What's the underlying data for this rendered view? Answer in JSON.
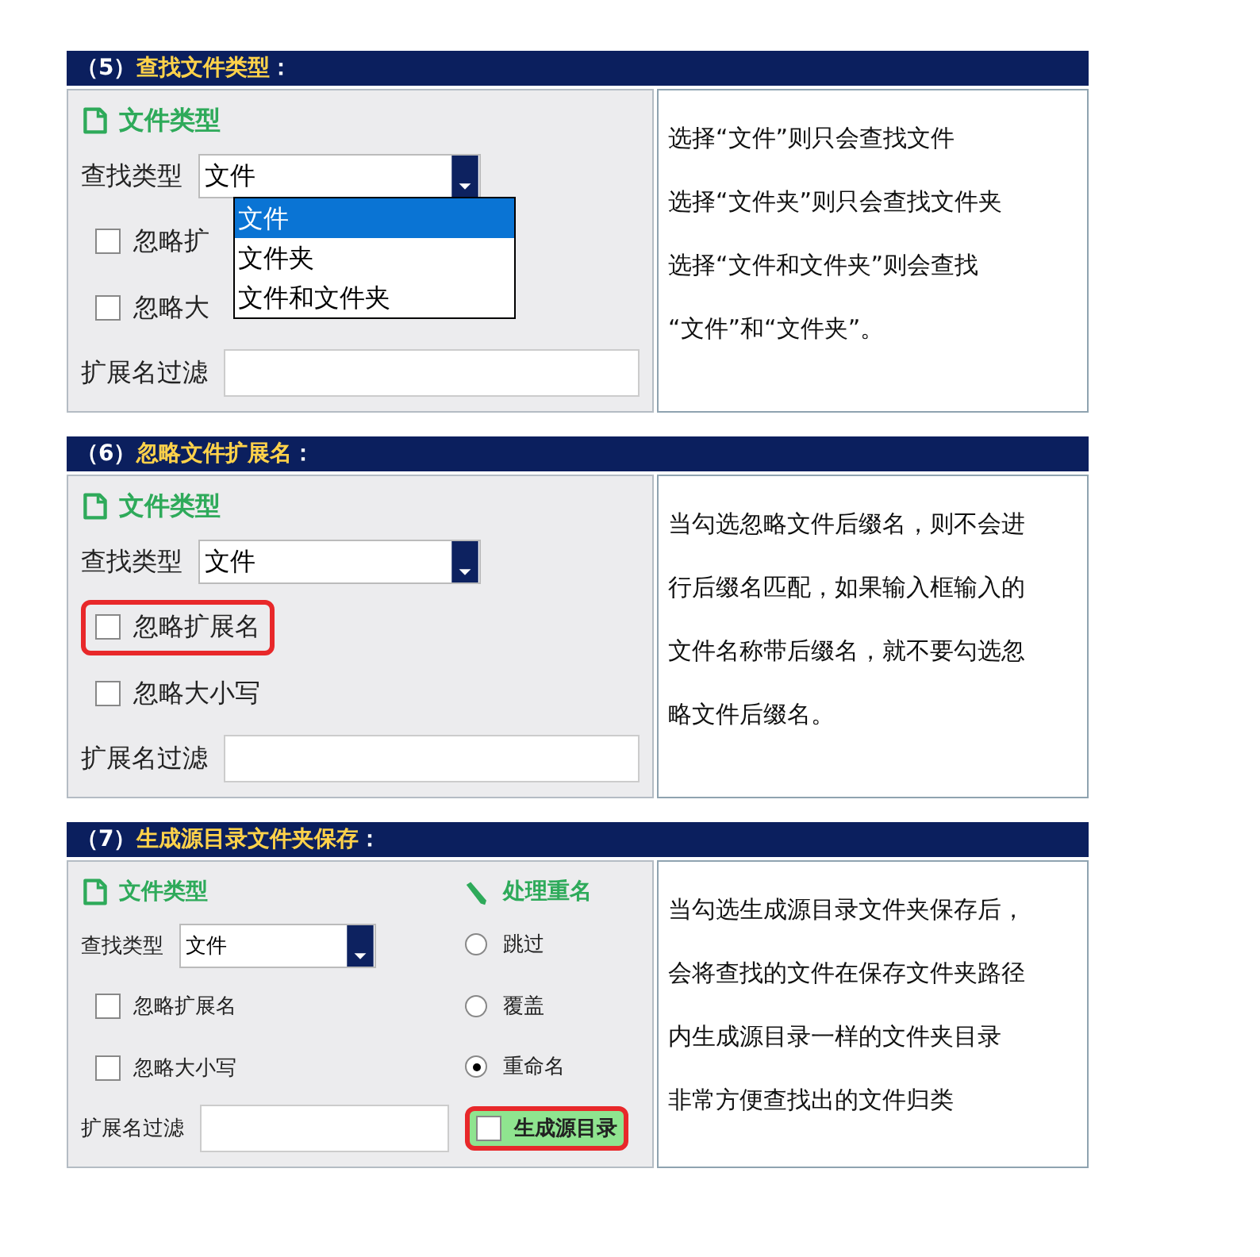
{
  "sections": [
    {
      "number": "（5）",
      "title": "查找文件类型",
      "suffix": "：",
      "file_type": {
        "heading": "文件类型",
        "search_type_label": "查找类型",
        "search_type_value": "文件",
        "dropdown_options": [
          {
            "label": "文件",
            "selected": true
          },
          {
            "label": "文件夹",
            "selected": false
          },
          {
            "label": "文件和文件夹",
            "selected": false
          }
        ],
        "checkboxes": [
          {
            "label": "忽略扩",
            "checked": false,
            "highlighted": false
          },
          {
            "label": "忽略大",
            "checked": false,
            "highlighted": false
          }
        ],
        "ext_filter_label": "扩展名过滤"
      },
      "description": [
        "选择“文件”则只会查找文件",
        "选择“文件夹”则只会查找文件夹",
        "选择“文件和文件夹”则会查找",
        "“文件”和“文件夹”。"
      ]
    },
    {
      "number": "（6）",
      "title": "忽略文件扩展名",
      "suffix": "：",
      "file_type": {
        "heading": "文件类型",
        "search_type_label": "查找类型",
        "search_type_value": "文件",
        "checkboxes": [
          {
            "label": "忽略扩展名",
            "checked": false,
            "highlighted": true
          },
          {
            "label": "忽略大小写",
            "checked": false,
            "highlighted": false
          }
        ],
        "ext_filter_label": "扩展名过滤"
      },
      "description": [
        "当勾选忽略文件后缀名，则不会进",
        "行后缀名匹配，如果输入框输入的",
        "文件名称带后缀名，就不要勾选忽",
        "略文件后缀名。"
      ]
    },
    {
      "number": "（7）",
      "title": "生成源目录文件夹保存",
      "suffix": "：",
      "file_type": {
        "heading": "文件类型",
        "search_type_label": "查找类型",
        "search_type_value": "文件",
        "checkboxes": [
          {
            "label": "忽略扩展名",
            "checked": false,
            "highlighted": false
          },
          {
            "label": "忽略大小写",
            "checked": false,
            "highlighted": false
          }
        ],
        "ext_filter_label": "扩展名过滤"
      },
      "rename": {
        "heading": "处理重名",
        "options": [
          {
            "label": "跳过",
            "selected": false
          },
          {
            "label": "覆盖",
            "selected": false
          },
          {
            "label": "重命名",
            "selected": true
          }
        ],
        "generate": {
          "label": "生成源目录",
          "checked": false,
          "highlighted": true
        }
      },
      "description": [
        "当勾选生成源目录文件夹保存后，",
        "会将查找的文件在保存文件夹路径",
        "内生成源目录一样的文件夹目录",
        "非常方便查找出的文件归类"
      ]
    }
  ]
}
